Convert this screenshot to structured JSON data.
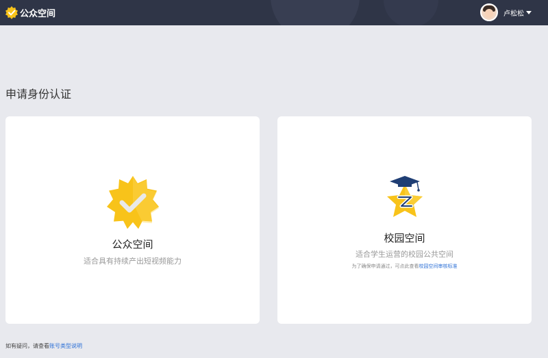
{
  "header": {
    "app_name": "公众空间",
    "user_name": "卢松松"
  },
  "page": {
    "title": "申请身份认证"
  },
  "cards": [
    {
      "title": "公众空间",
      "desc": "适合具有持续产出短视频能力"
    },
    {
      "title": "校园空间",
      "desc": "适合学生运营的校园公共空间",
      "note_prefix": "为了确保申请通过，可点此查看",
      "note_link": "校园空间审核标准"
    }
  ],
  "footer": {
    "prefix": "如有疑问，请查看",
    "link": "账号类型说明"
  },
  "colors": {
    "topbar": "#2f3547",
    "background": "#e8e9ee",
    "accent_yellow": "#f8c31a",
    "link": "#2b6fd6",
    "navy": "#1f3e74"
  },
  "icons": [
    "verified-badge-icon",
    "campus-star-icon",
    "caret-down-icon"
  ]
}
